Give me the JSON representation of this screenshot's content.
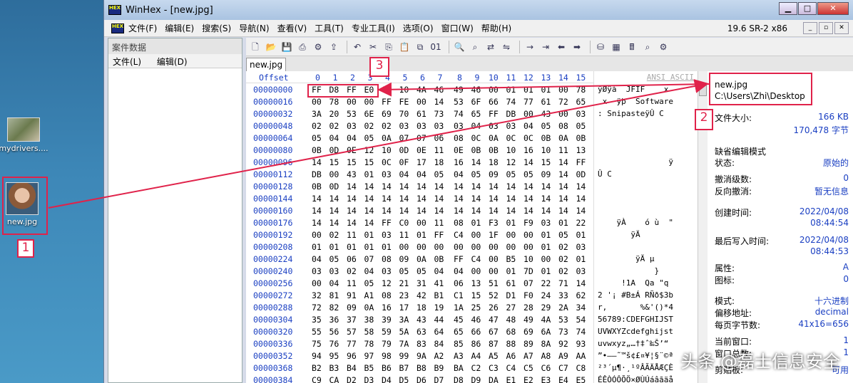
{
  "desktop": {
    "icons": [
      {
        "label": "mydrivers...."
      },
      {
        "label": "new.jpg"
      }
    ]
  },
  "window": {
    "title": "WinHex - [new.jpg]",
    "logo": "HEX",
    "controls": [
      "minimize-icon",
      "maximize-icon",
      "close-icon"
    ]
  },
  "menubar": {
    "items": [
      "文件(F)",
      "编辑(E)",
      "搜索(S)",
      "导航(N)",
      "查看(V)",
      "工具(T)",
      "专业工具(I)",
      "选项(O)",
      "窗口(W)",
      "帮助(H)"
    ],
    "version": "19.6 SR-2 x86"
  },
  "left_panel": {
    "title": "案件数据",
    "menu": [
      "文件(L)",
      "编辑(D)"
    ]
  },
  "tab": {
    "label": "new.jpg"
  },
  "hex": {
    "offset_header": "Offset",
    "col_headers": [
      "0",
      "1",
      "2",
      "3",
      "4",
      "5",
      "6",
      "7",
      "8",
      "9",
      "10",
      "11",
      "12",
      "13",
      "14",
      "15"
    ],
    "ascii_header": "ANSI ASCII",
    "rows": [
      {
        "offset": "00000000",
        "bytes": [
          "FF",
          "D8",
          "FF",
          "E0",
          "00",
          "10",
          "4A",
          "46",
          "49",
          "46",
          "00",
          "01",
          "01",
          "01",
          "00",
          "78"
        ],
        "ascii": "ÿØÿà  JFIF    x"
      },
      {
        "offset": "00000016",
        "bytes": [
          "00",
          "78",
          "00",
          "00",
          "FF",
          "FE",
          "00",
          "14",
          "53",
          "6F",
          "66",
          "74",
          "77",
          "61",
          "72",
          "65"
        ],
        "ascii": " x  ÿþ  Software"
      },
      {
        "offset": "00000032",
        "bytes": [
          "3A",
          "20",
          "53",
          "6E",
          "69",
          "70",
          "61",
          "73",
          "74",
          "65",
          "FF",
          "DB",
          "00",
          "43",
          "00",
          "03"
        ],
        "ascii": ": SnipasteÿÛ C "
      },
      {
        "offset": "00000048",
        "bytes": [
          "02",
          "02",
          "03",
          "02",
          "02",
          "03",
          "03",
          "03",
          "03",
          "04",
          "03",
          "03",
          "04",
          "05",
          "08",
          "05"
        ],
        "ascii": ""
      },
      {
        "offset": "00000064",
        "bytes": [
          "05",
          "04",
          "04",
          "05",
          "0A",
          "07",
          "07",
          "06",
          "08",
          "0C",
          "0A",
          "0C",
          "0C",
          "0B",
          "0A",
          "0B"
        ],
        "ascii": ""
      },
      {
        "offset": "00000080",
        "bytes": [
          "0B",
          "0D",
          "0E",
          "12",
          "10",
          "0D",
          "0E",
          "11",
          "0E",
          "0B",
          "0B",
          "10",
          "16",
          "10",
          "11",
          "13"
        ],
        "ascii": ""
      },
      {
        "offset": "00000096",
        "bytes": [
          "14",
          "15",
          "15",
          "15",
          "0C",
          "0F",
          "17",
          "18",
          "16",
          "14",
          "18",
          "12",
          "14",
          "15",
          "14",
          "FF"
        ],
        "ascii": "               ÿ"
      },
      {
        "offset": "00000112",
        "bytes": [
          "DB",
          "00",
          "43",
          "01",
          "03",
          "04",
          "04",
          "05",
          "04",
          "05",
          "09",
          "05",
          "05",
          "09",
          "14",
          "0D"
        ],
        "ascii": "Û C"
      },
      {
        "offset": "00000128",
        "bytes": [
          "0B",
          "0D",
          "14",
          "14",
          "14",
          "14",
          "14",
          "14",
          "14",
          "14",
          "14",
          "14",
          "14",
          "14",
          "14",
          "14"
        ],
        "ascii": ""
      },
      {
        "offset": "00000144",
        "bytes": [
          "14",
          "14",
          "14",
          "14",
          "14",
          "14",
          "14",
          "14",
          "14",
          "14",
          "14",
          "14",
          "14",
          "14",
          "14",
          "14"
        ],
        "ascii": ""
      },
      {
        "offset": "00000160",
        "bytes": [
          "14",
          "14",
          "14",
          "14",
          "14",
          "14",
          "14",
          "14",
          "14",
          "14",
          "14",
          "14",
          "14",
          "14",
          "14",
          "14"
        ],
        "ascii": ""
      },
      {
        "offset": "00000176",
        "bytes": [
          "14",
          "14",
          "14",
          "14",
          "FF",
          "C0",
          "00",
          "11",
          "08",
          "01",
          "F3",
          "01",
          "F9",
          "03",
          "01",
          "22"
        ],
        "ascii": "    ÿÀ    ó ù  \""
      },
      {
        "offset": "00000192",
        "bytes": [
          "00",
          "02",
          "11",
          "01",
          "03",
          "11",
          "01",
          "FF",
          "C4",
          "00",
          "1F",
          "00",
          "00",
          "01",
          "05",
          "01"
        ],
        "ascii": "       ÿÄ"
      },
      {
        "offset": "00000208",
        "bytes": [
          "01",
          "01",
          "01",
          "01",
          "01",
          "00",
          "00",
          "00",
          "00",
          "00",
          "00",
          "00",
          "00",
          "01",
          "02",
          "03"
        ],
        "ascii": ""
      },
      {
        "offset": "00000224",
        "bytes": [
          "04",
          "05",
          "06",
          "07",
          "08",
          "09",
          "0A",
          "0B",
          "FF",
          "C4",
          "00",
          "B5",
          "10",
          "00",
          "02",
          "01"
        ],
        "ascii": "        ÿÄ µ"
      },
      {
        "offset": "00000240",
        "bytes": [
          "03",
          "03",
          "02",
          "04",
          "03",
          "05",
          "05",
          "04",
          "04",
          "00",
          "00",
          "01",
          "7D",
          "01",
          "02",
          "03"
        ],
        "ascii": "            }"
      },
      {
        "offset": "00000256",
        "bytes": [
          "00",
          "04",
          "11",
          "05",
          "12",
          "21",
          "31",
          "41",
          "06",
          "13",
          "51",
          "61",
          "07",
          "22",
          "71",
          "14"
        ],
        "ascii": "     !1A  Qa \"q"
      },
      {
        "offset": "00000272",
        "bytes": [
          "32",
          "81",
          "91",
          "A1",
          "08",
          "23",
          "42",
          "B1",
          "C1",
          "15",
          "52",
          "D1",
          "F0",
          "24",
          "33",
          "62"
        ],
        "ascii": "2 '¡ #B±Á RÑð$3b"
      },
      {
        "offset": "00000288",
        "bytes": [
          "72",
          "82",
          "09",
          "0A",
          "16",
          "17",
          "18",
          "19",
          "1A",
          "25",
          "26",
          "27",
          "28",
          "29",
          "2A",
          "34"
        ],
        "ascii": "r,       %&'()*4"
      },
      {
        "offset": "00000304",
        "bytes": [
          "35",
          "36",
          "37",
          "38",
          "39",
          "3A",
          "43",
          "44",
          "45",
          "46",
          "47",
          "48",
          "49",
          "4A",
          "53",
          "54"
        ],
        "ascii": "56789:CDEFGHIJST"
      },
      {
        "offset": "00000320",
        "bytes": [
          "55",
          "56",
          "57",
          "58",
          "59",
          "5A",
          "63",
          "64",
          "65",
          "66",
          "67",
          "68",
          "69",
          "6A",
          "73",
          "74"
        ],
        "ascii": "UVWXYZcdefghijst"
      },
      {
        "offset": "00000336",
        "bytes": [
          "75",
          "76",
          "77",
          "78",
          "79",
          "7A",
          "83",
          "84",
          "85",
          "86",
          "87",
          "88",
          "89",
          "8A",
          "92",
          "93"
        ],
        "ascii": "uvwxyz„…†‡ˆ‰Š’“"
      },
      {
        "offset": "00000352",
        "bytes": [
          "94",
          "95",
          "96",
          "97",
          "98",
          "99",
          "9A",
          "A2",
          "A3",
          "A4",
          "A5",
          "A6",
          "A7",
          "A8",
          "A9",
          "AA"
        ],
        "ascii": "”•–—˜™š¢£¤¥¦§¨©ª"
      },
      {
        "offset": "00000368",
        "bytes": [
          "B2",
          "B3",
          "B4",
          "B5",
          "B6",
          "B7",
          "B8",
          "B9",
          "BA",
          "C2",
          "C3",
          "C4",
          "C5",
          "C6",
          "C7",
          "C8"
        ],
        "ascii": "²³´µ¶·¸¹ºÂÃÄÅÆÇÈ"
      },
      {
        "offset": "00000384",
        "bytes": [
          "C9",
          "CA",
          "D2",
          "D3",
          "D4",
          "D5",
          "D6",
          "D7",
          "D8",
          "D9",
          "DA",
          "E1",
          "E2",
          "E3",
          "E4",
          "E5"
        ],
        "ascii": "ÉÊÒÓÔÕÖ×ØÙÚáâãäå"
      }
    ]
  },
  "info": {
    "filename": "new.jpg",
    "path": "C:\\Users\\Zhi\\Desktop",
    "size_label": "文件大小:",
    "size_kb": "166 KB",
    "size_bytes": "170,478 字节",
    "edit_mode": "缺省编辑模式",
    "state_label": "状态:",
    "state_value": "原始的",
    "undo_label": "撤消级数:",
    "undo_value": "0",
    "redo_label": "反向撤消:",
    "redo_value": "暂无信息",
    "created_label": "创建时间:",
    "created_date": "2022/04/08",
    "created_time": "08:44:54",
    "modified_label": "最后写入时间:",
    "modified_date": "2022/04/08",
    "modified_time": "08:44:53",
    "attr_label": "属性:",
    "attr_value": "A",
    "icon_label": "图标:",
    "icon_value": "0",
    "mode_label": "模式:",
    "mode_value": "十六进制",
    "offset_label": "偏移地址:",
    "offset_value": "decimal",
    "perpage_label": "每页字节数:",
    "perpage_value": "41x16=656",
    "curwin_label": "当前窗口:",
    "curwin_value": "1",
    "totalwin_label": "窗口总数:",
    "totalwin_value": "1",
    "clipboard_label": "剪贴板:",
    "clipboard_value": "可用"
  },
  "annotations": [
    "1",
    "2",
    "3"
  ],
  "watermark": "头条 @磊士信息安全",
  "colors": {
    "annotation": "#e0224a",
    "offset_text": "#1a3fc2"
  }
}
